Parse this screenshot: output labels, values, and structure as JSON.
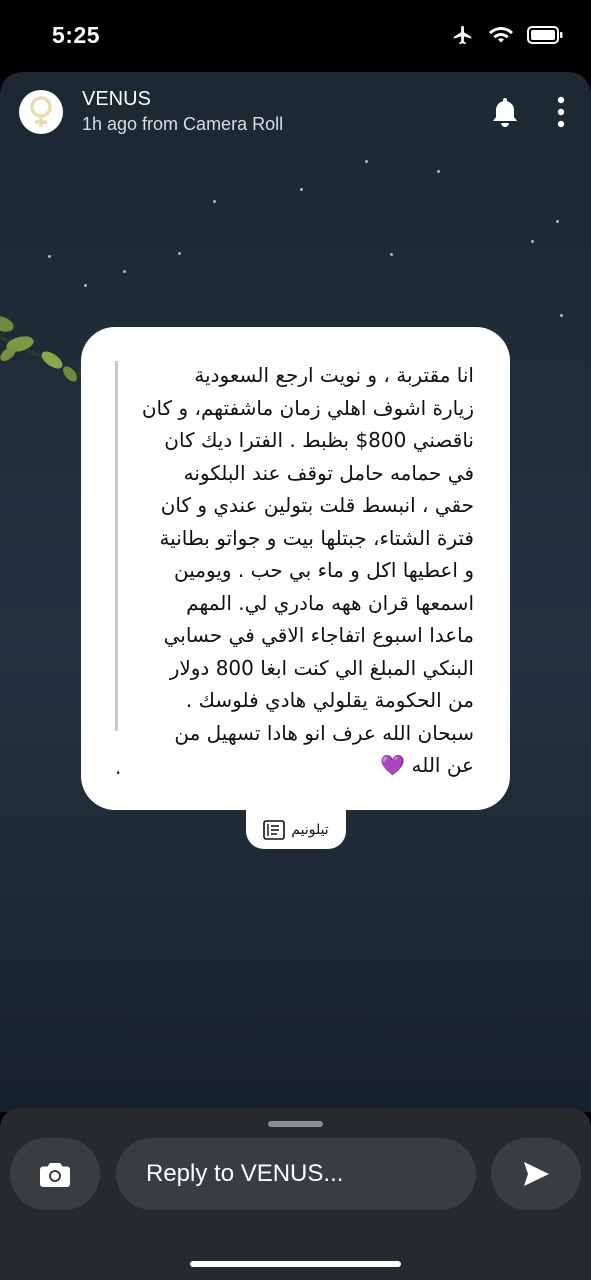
{
  "status_bar": {
    "time": "5:25",
    "icons": [
      "airplane-icon",
      "wifi-icon",
      "battery-icon"
    ]
  },
  "story": {
    "user_name": "VENUS",
    "subtitle": "1h ago from Camera Roll",
    "card_text": "انا مقتربة ، و نويت ارجع السعودية\nزيارة اشوف اهلي زمان ماشفتهم، و كان\nناقصني 800$ بظبط . الفترا ديك كان\nفي حمامه حامل توقف عند البلكونه\nحقي ، انبسط قلت بتولين عندي و كان\nفترة الشتاء، جبتلها بيت و جواتو بطانية\nو اعطيها اكل و ماء بي حب . ويومين\nاسمعها قران ههه مادري لي. المهم\nماعدا اسبوع اتفاجاء الاقي في حسابي\nالبنكي المبلغ الي كنت ابغا 800 دولار\nمن الحكومة يقلولي هادي فلوسك .\nسبحان الله عرف انو هادا تسهيل من\nعن الله 💜",
    "trailing_dot": ".",
    "source_label": "تيلونيم"
  },
  "reply": {
    "placeholder": "Reply to VENUS..."
  },
  "colors": {
    "card_bg": "#ffffff",
    "bottom_bar": "#272a2d",
    "button_bg": "#3a3d40"
  }
}
